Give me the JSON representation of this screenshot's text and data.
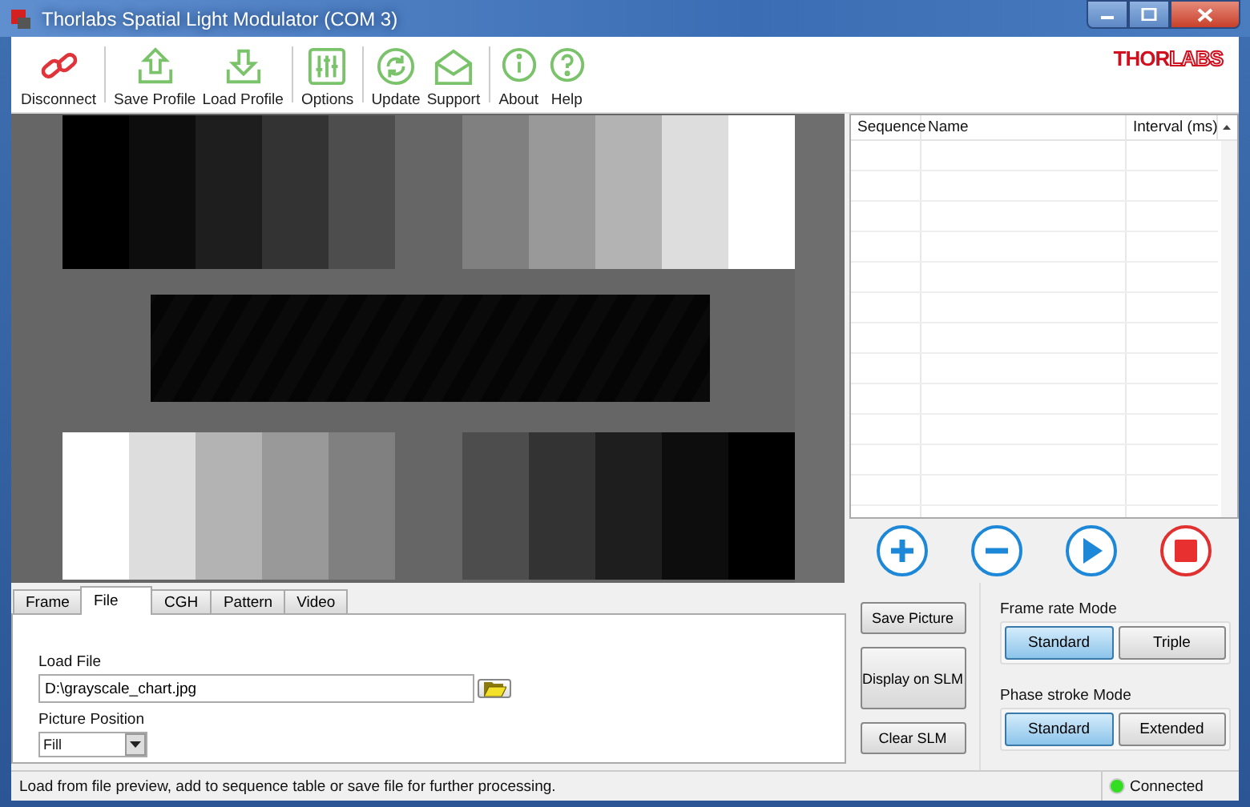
{
  "window": {
    "title": "Thorlabs Spatial Light Modulator (COM 3)"
  },
  "toolbar": [
    {
      "label": "Disconnect",
      "kind": "link",
      "separator_after": true
    },
    {
      "label": "Save Profile",
      "kind": "upload",
      "separator_after": false
    },
    {
      "label": "Load Profile",
      "kind": "download",
      "separator_after": true
    },
    {
      "label": "Options",
      "kind": "sliders",
      "separator_after": true
    },
    {
      "label": "Update",
      "kind": "refresh",
      "separator_after": false
    },
    {
      "label": "Support",
      "kind": "mail",
      "separator_after": true
    },
    {
      "label": "About",
      "kind": "info",
      "separator_after": false
    },
    {
      "label": "Help",
      "kind": "help",
      "separator_after": false
    }
  ],
  "logo": {
    "bold": "THOR",
    "outline": "LABS"
  },
  "sequence_table": {
    "columns": [
      "Sequence",
      "Name",
      "Interval (ms)"
    ]
  },
  "sequence_buttons": [
    {
      "kind": "add"
    },
    {
      "kind": "remove"
    },
    {
      "kind": "play"
    },
    {
      "kind": "stop"
    }
  ],
  "tabs": [
    {
      "label": "Frame",
      "selected": false
    },
    {
      "label": "File",
      "selected": true
    },
    {
      "label": "CGH",
      "selected": false
    },
    {
      "label": "Pattern",
      "selected": false
    },
    {
      "label": "Video",
      "selected": false
    }
  ],
  "file_panel": {
    "load_file_label": "Load File",
    "path": "D:\\grayscale_chart.jpg",
    "position_label": "Picture Position",
    "position": "Fill"
  },
  "actions": [
    "Save Picture",
    "Display on SLM",
    "Clear SLM"
  ],
  "frame_rate_mode": {
    "title": "Frame rate Mode",
    "options": [
      {
        "label": "Standard",
        "selected": true
      },
      {
        "label": "Triple",
        "selected": false
      }
    ]
  },
  "phase_stroke_mode": {
    "title": "Phase stroke Mode",
    "options": [
      {
        "label": "Standard",
        "selected": true
      },
      {
        "label": "Extended",
        "selected": false
      }
    ]
  },
  "status_bar": {
    "message": "Load from file preview, add to sequence table or save file for further processing.",
    "connection": "Connected",
    "connected": true
  }
}
